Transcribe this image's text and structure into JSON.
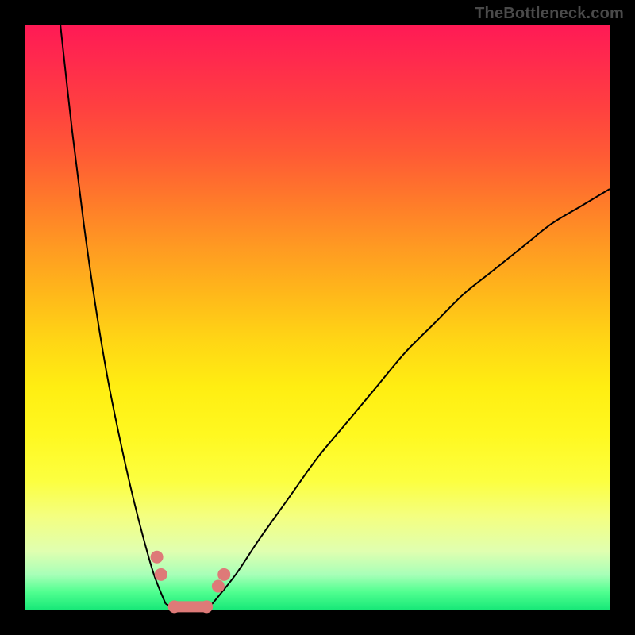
{
  "watermark": "TheBottleneck.com",
  "colors": {
    "frame": "#000000",
    "watermark_text": "#4a4a4a",
    "curve": "#000000",
    "marker": "#de7a78",
    "gradient_top": "#ff1a55",
    "gradient_bottom": "#18e878"
  },
  "chart_data": {
    "type": "line",
    "title": "",
    "xlabel": "",
    "ylabel": "",
    "xlim": [
      0,
      100
    ],
    "ylim": [
      0,
      100
    ],
    "notes": "Bottleneck-style V curve; y ≈ bottleneck % (0 at bottom, 100 at top). Minimum region ≈ x 24–32 at y≈0. Left branch rises steeply to y≈100 near x≈6; right branch rises to y≈72 at x=100.",
    "series": [
      {
        "name": "left-branch",
        "x": [
          6,
          8,
          10,
          12,
          14,
          16,
          18,
          20,
          22,
          24
        ],
        "y": [
          100,
          82,
          66,
          52,
          40,
          30,
          21,
          13,
          6,
          1
        ]
      },
      {
        "name": "valley",
        "x": [
          24,
          26,
          28,
          30,
          32
        ],
        "y": [
          1,
          0,
          0,
          0,
          1
        ]
      },
      {
        "name": "right-branch",
        "x": [
          32,
          36,
          40,
          45,
          50,
          55,
          60,
          65,
          70,
          75,
          80,
          85,
          90,
          95,
          100
        ],
        "y": [
          1,
          6,
          12,
          19,
          26,
          32,
          38,
          44,
          49,
          54,
          58,
          62,
          66,
          69,
          72
        ]
      }
    ],
    "markers": [
      {
        "name": "left-dot-upper",
        "x": 22.5,
        "y": 9
      },
      {
        "name": "left-dot-lower",
        "x": 23.2,
        "y": 6
      },
      {
        "name": "valley-dot-L",
        "x": 25.5,
        "y": 0.5
      },
      {
        "name": "valley-dot-R",
        "x": 31.0,
        "y": 0.5
      },
      {
        "name": "right-dot-lower",
        "x": 33.0,
        "y": 4
      },
      {
        "name": "right-dot-upper",
        "x": 34.0,
        "y": 6
      }
    ],
    "highlight_segment": {
      "from": {
        "x": 25.5,
        "y": 0.5
      },
      "to": {
        "x": 31.0,
        "y": 0.5
      }
    }
  }
}
